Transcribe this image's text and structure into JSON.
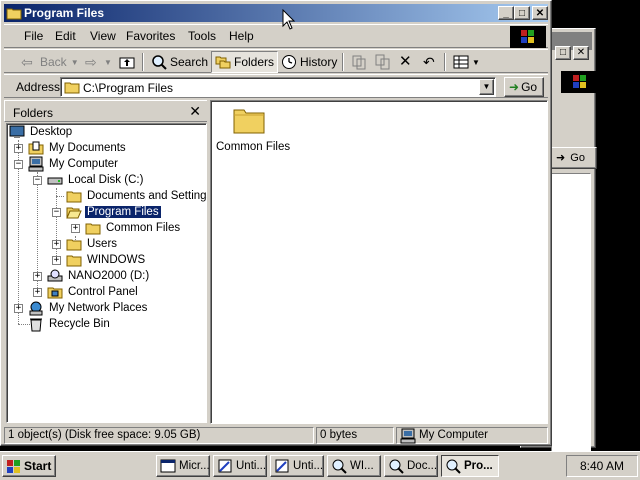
{
  "window": {
    "title": "Program Files",
    "controls": {
      "minimize": "_",
      "maximize": "□",
      "close": "✕"
    }
  },
  "background_window": {
    "go_label": "Go",
    "close": "✕",
    "maximize": "□"
  },
  "menubar": {
    "items": [
      "File",
      "Edit",
      "View",
      "Favorites",
      "Tools",
      "Help"
    ],
    "brand_icon": "windows-logo-icon"
  },
  "toolbar": {
    "back_label": "Back",
    "search_label": "Search",
    "folders_label": "Folders",
    "history_label": "History"
  },
  "address": {
    "label": "Address",
    "value": "C:\\Program Files",
    "go_label": "Go"
  },
  "folders_pane": {
    "header": "Folders",
    "close": "✕",
    "tree": [
      {
        "label": "Desktop"
      },
      {
        "label": "My Documents"
      },
      {
        "label": "My Computer"
      },
      {
        "label": "Local Disk (C:)"
      },
      {
        "label": "Documents and Settings"
      },
      {
        "label": "Program Files"
      },
      {
        "label": "Common Files"
      },
      {
        "label": "Users"
      },
      {
        "label": "WINDOWS"
      },
      {
        "label": "NANO2000 (D:)"
      },
      {
        "label": "Control Panel"
      },
      {
        "label": "My Network Places"
      },
      {
        "label": "Recycle Bin"
      }
    ]
  },
  "content": {
    "items": [
      {
        "label": "Common Files",
        "icon": "folder-icon"
      }
    ]
  },
  "statusbar": {
    "objects": "1 object(s) (Disk free space: 9.05 GB)",
    "size": "0 bytes",
    "zone": "My Computer"
  },
  "taskbar": {
    "start_label": "Start",
    "buttons": [
      "Micr...",
      "Unti...",
      "Unti...",
      "WI...",
      "Doc...",
      "Pro..."
    ],
    "clock": "8:40 AM"
  },
  "colors": {
    "title_active": "#0a246a",
    "title_gradient_end": "#a6caf0",
    "face": "#d4d0c8",
    "selection": "#0a246a"
  }
}
